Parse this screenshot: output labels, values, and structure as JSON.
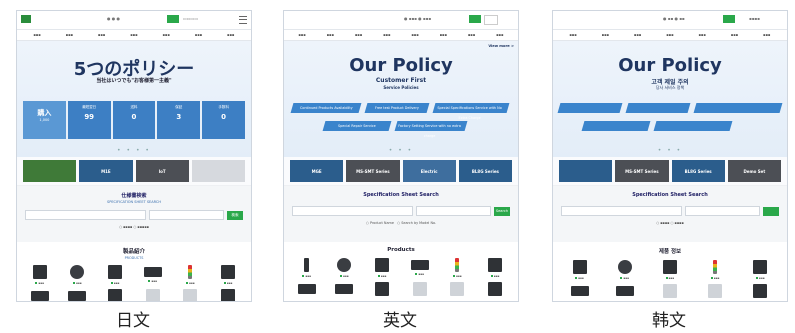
{
  "jp": {
    "caption": "日文",
    "hero_title": "5つのポリシー",
    "hero_sub": "当社はいつでも\"お客様第一主義\"",
    "bars": [
      {
        "label": "購入",
        "big": "購入",
        "sub": "1,000"
      },
      {
        "label": "最短翌日",
        "big": "99",
        "sub": ""
      },
      {
        "label": "送料",
        "big": "0",
        "sub": ""
      },
      {
        "label": "保証",
        "big": "3",
        "sub": ""
      },
      {
        "label": "手数料",
        "big": "0",
        "sub": ""
      }
    ],
    "banners": [
      "M1E",
      "IoT",
      "",
      ""
    ],
    "search_title": "仕様書検索",
    "search_sub": "SPECIFICATION SHEET SEARCH",
    "search_button": "検索",
    "products_title": "製品紹介",
    "products_sub": "PRODUCTS"
  },
  "en": {
    "caption": "英文",
    "hero_title": "Our Policy",
    "hero_sub": "Customer First",
    "hero_sub2": "Service Policies",
    "view_more": "View more >",
    "policies": [
      "Continued Products Availability",
      "Free test Product Delivery",
      "Special Specifications Service with No Extra Charge",
      "Special Repair Service",
      "Factory Setting Service with no extra charge"
    ],
    "banners": [
      "MGE",
      "MS-SMT Series",
      "Electric",
      "BL8G Series"
    ],
    "search_title": "Specification Sheet Search",
    "search_button": "Search",
    "radio1": "Product Name",
    "radio2": "Search by Model No.",
    "products_title": "Products"
  },
  "kr": {
    "caption": "韩文",
    "hero_title": "Our Policy",
    "hero_sub": "고객 제일 주의",
    "hero_sub2": "당사 서비스 정책",
    "banners": [
      "",
      "MS-SMT Series",
      "BL8G Series",
      "Demo Set"
    ],
    "search_title": "Specification Sheet Search",
    "search_button": "",
    "products_title": "제품 정보",
    "more": "more"
  }
}
